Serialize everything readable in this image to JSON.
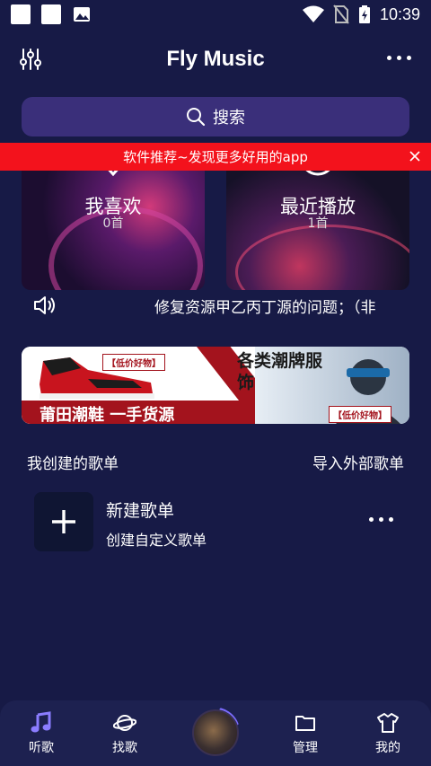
{
  "status_bar": {
    "time": "10:39"
  },
  "header": {
    "title": "Fly Music"
  },
  "search": {
    "label": "搜索"
  },
  "promo": {
    "text": "软件推荐~发现更多好用的app"
  },
  "cards": [
    {
      "title": "我喜欢",
      "count": "0首"
    },
    {
      "title": "最近播放",
      "count": "1首"
    }
  ],
  "announcement": {
    "text": "修复资源甲乙丙丁源的问题；（非"
  },
  "banner": {
    "tag_left": "【低价好物】",
    "main_left": "莆田潮鞋  一手货源",
    "main_right": "各类潮牌服饰",
    "tag_right": "【低价好物】"
  },
  "playlists": {
    "section_title": "我创建的歌单",
    "import_label": "导入外部歌单",
    "new_title": "新建歌单",
    "new_subtitle": "创建自定义歌单"
  },
  "bottom_nav": {
    "items": [
      {
        "label": "听歌",
        "icon": "music-note-icon"
      },
      {
        "label": "找歌",
        "icon": "planet-icon"
      },
      {
        "label": "管理",
        "icon": "folder-icon"
      },
      {
        "label": "我的",
        "icon": "shirt-icon"
      }
    ]
  },
  "colors": {
    "background": "#171a46",
    "search_bg": "#3a2f7a",
    "promo_bg": "#f3121c",
    "nav_bg": "#1d2150",
    "accent": "#7b6cff"
  }
}
